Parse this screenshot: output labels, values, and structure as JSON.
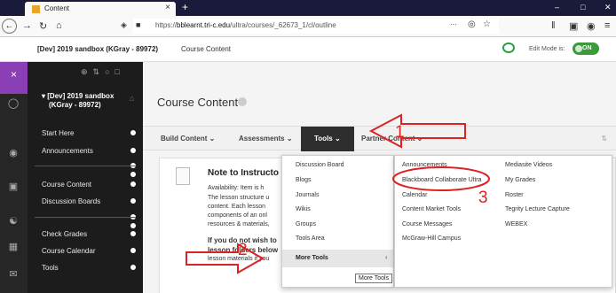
{
  "browser": {
    "tab_title": "Content",
    "tab_close": "×",
    "new_tab": "+",
    "url_prefix": "https://",
    "url_host": "bblearnt.tri-c.edu",
    "url_path": "/ultra/courses/_62673_1/cl/outline",
    "url_more": "···",
    "window_controls": [
      "–",
      "□",
      "✕"
    ]
  },
  "header": {
    "course_title": "[Dev] 2019 sandbox (KGray - 89972)",
    "page_crumb": "Course Content",
    "edit_mode_label": "Edit Mode is:",
    "edit_mode_value": "ON"
  },
  "course_menu": {
    "course_name_line1": "[Dev] 2019 sandbox",
    "course_name_line2": "(KGray - 89972)",
    "items": [
      {
        "label": "Start Here"
      },
      {
        "label": "Announcements"
      },
      {
        "label": "Course Content"
      },
      {
        "label": "Discussion Boards"
      },
      {
        "label": "Check Grades"
      },
      {
        "label": "Course Calendar"
      },
      {
        "label": "Tools"
      }
    ]
  },
  "main": {
    "page_title": "Course Content",
    "action_bar": {
      "build_content": "Build Content",
      "assessments": "Assessments",
      "tools": "Tools",
      "partner_content": "Partner Content"
    },
    "item": {
      "title": "Note to Instructo",
      "availability": "Availability:  Item is h",
      "lines": [
        "The lesson structure u",
        "content.  Each lesson",
        "components of an onl",
        "resources & materials,"
      ],
      "bold_line1": "If you do not wish to",
      "bold_line2": "lesson folders below",
      "last_line": "lesson materials if you"
    }
  },
  "tools_menu": {
    "items": [
      "Discussion Board",
      "Blogs",
      "Journals",
      "Wikis",
      "Groups",
      "Tools Area"
    ],
    "more_tools": "More Tools",
    "tooltip": "More Tools"
  },
  "more_tools_menu": {
    "col1": [
      "Announcements",
      "Blackboard Collaborate Ultra",
      "Calendar",
      "Content Market Tools",
      "Course Messages",
      "McGraw-Hill Campus"
    ],
    "col2": [
      "Mediasite Videos",
      "My Grades",
      "Roster",
      "Tegrity Lecture Capture",
      "WEBEX"
    ]
  },
  "annotations": {
    "numbers": [
      "1",
      "2",
      "3"
    ],
    "color": "#dd2222"
  },
  "colors": {
    "rail_accent": "#8b3fb5",
    "edit_on": "#3c9a3c",
    "menu_bg": "#1c1c1c"
  }
}
